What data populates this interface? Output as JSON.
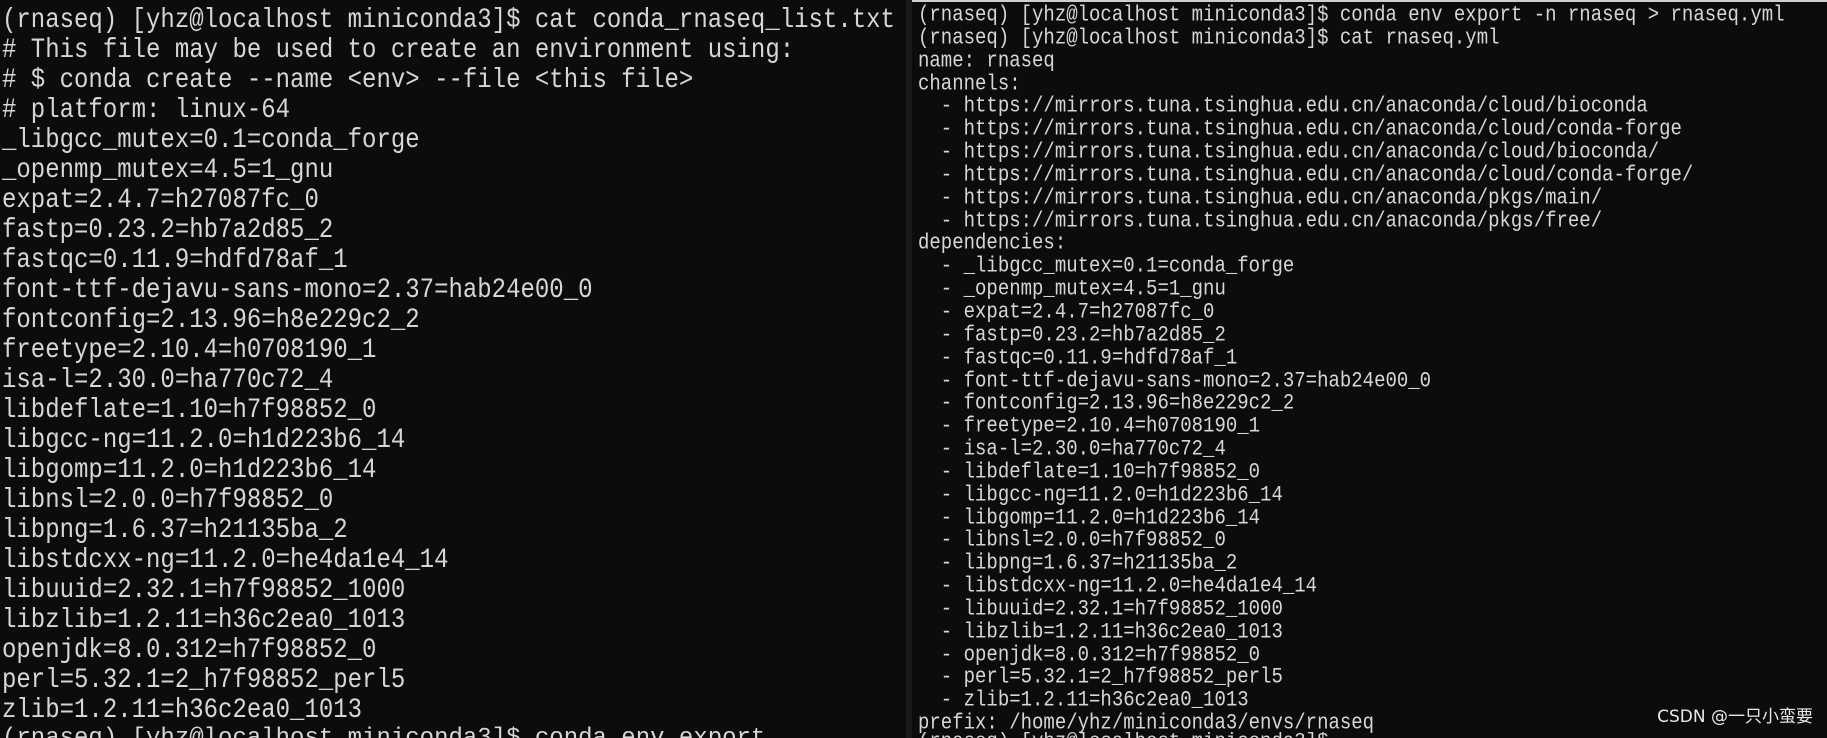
{
  "left_terminal": {
    "lines": [
      "(rnaseq) [yhz@localhost miniconda3]$ cat conda_rnaseq_list.txt",
      "# This file may be used to create an environment using:",
      "# $ conda create --name <env> --file <this file>",
      "# platform: linux-64",
      "_libgcc_mutex=0.1=conda_forge",
      "_openmp_mutex=4.5=1_gnu",
      "expat=2.4.7=h27087fc_0",
      "fastp=0.23.2=hb7a2d85_2",
      "fastqc=0.11.9=hdfd78af_1",
      "font-ttf-dejavu-sans-mono=2.37=hab24e00_0",
      "fontconfig=2.13.96=h8e229c2_2",
      "freetype=2.10.4=h0708190_1",
      "isa-l=2.30.0=ha770c72_4",
      "libdeflate=1.10=h7f98852_0",
      "libgcc-ng=11.2.0=h1d223b6_14",
      "libgomp=11.2.0=h1d223b6_14",
      "libnsl=2.0.0=h7f98852_0",
      "libpng=1.6.37=h21135ba_2",
      "libstdcxx-ng=11.2.0=he4da1e4_14",
      "libuuid=2.32.1=h7f98852_1000",
      "libzlib=1.2.11=h36c2ea0_1013",
      "openjdk=8.0.312=h7f98852_0",
      "perl=5.32.1=2_h7f98852_perl5",
      "zlib=1.2.11=h36c2ea0_1013"
    ],
    "cutoff_bottom": "(rnaseq) [yhz@localhost miniconda3]$ conda env export"
  },
  "right_terminal": {
    "lines": [
      "(rnaseq) [yhz@localhost miniconda3]$ conda env export -n rnaseq > rnaseq.yml",
      "(rnaseq) [yhz@localhost miniconda3]$ cat rnaseq.yml",
      "name: rnaseq",
      "channels:",
      "  - https://mirrors.tuna.tsinghua.edu.cn/anaconda/cloud/bioconda",
      "  - https://mirrors.tuna.tsinghua.edu.cn/anaconda/cloud/conda-forge",
      "  - https://mirrors.tuna.tsinghua.edu.cn/anaconda/cloud/bioconda/",
      "  - https://mirrors.tuna.tsinghua.edu.cn/anaconda/cloud/conda-forge/",
      "  - https://mirrors.tuna.tsinghua.edu.cn/anaconda/pkgs/main/",
      "  - https://mirrors.tuna.tsinghua.edu.cn/anaconda/pkgs/free/",
      "dependencies:",
      "  - _libgcc_mutex=0.1=conda_forge",
      "  - _openmp_mutex=4.5=1_gnu",
      "  - expat=2.4.7=h27087fc_0",
      "  - fastp=0.23.2=hb7a2d85_2",
      "  - fastqc=0.11.9=hdfd78af_1",
      "  - font-ttf-dejavu-sans-mono=2.37=hab24e00_0",
      "  - fontconfig=2.13.96=h8e229c2_2",
      "  - freetype=2.10.4=h0708190_1",
      "  - isa-l=2.30.0=ha770c72_4",
      "  - libdeflate=1.10=h7f98852_0",
      "  - libgcc-ng=11.2.0=h1d223b6_14",
      "  - libgomp=11.2.0=h1d223b6_14",
      "  - libnsl=2.0.0=h7f98852_0",
      "  - libpng=1.6.37=h21135ba_2",
      "  - libstdcxx-ng=11.2.0=he4da1e4_14",
      "  - libuuid=2.32.1=h7f98852_1000",
      "  - libzlib=1.2.11=h36c2ea0_1013",
      "  - openjdk=8.0.312=h7f98852_0",
      "  - perl=5.32.1=2_h7f98852_perl5",
      "  - zlib=1.2.11=h36c2ea0_1013",
      "prefix: /home/yhz/miniconda3/envs/rnaseq"
    ],
    "cutoff_bottom": "(rnaseq) [yhz@localhost miniconda3]$"
  },
  "watermark": "CSDN @一只小蛮要",
  "colors": {
    "background": "#0c0c0c",
    "text": "#d6d6d6",
    "prompt_cutoff_top": "#3a78d8"
  }
}
